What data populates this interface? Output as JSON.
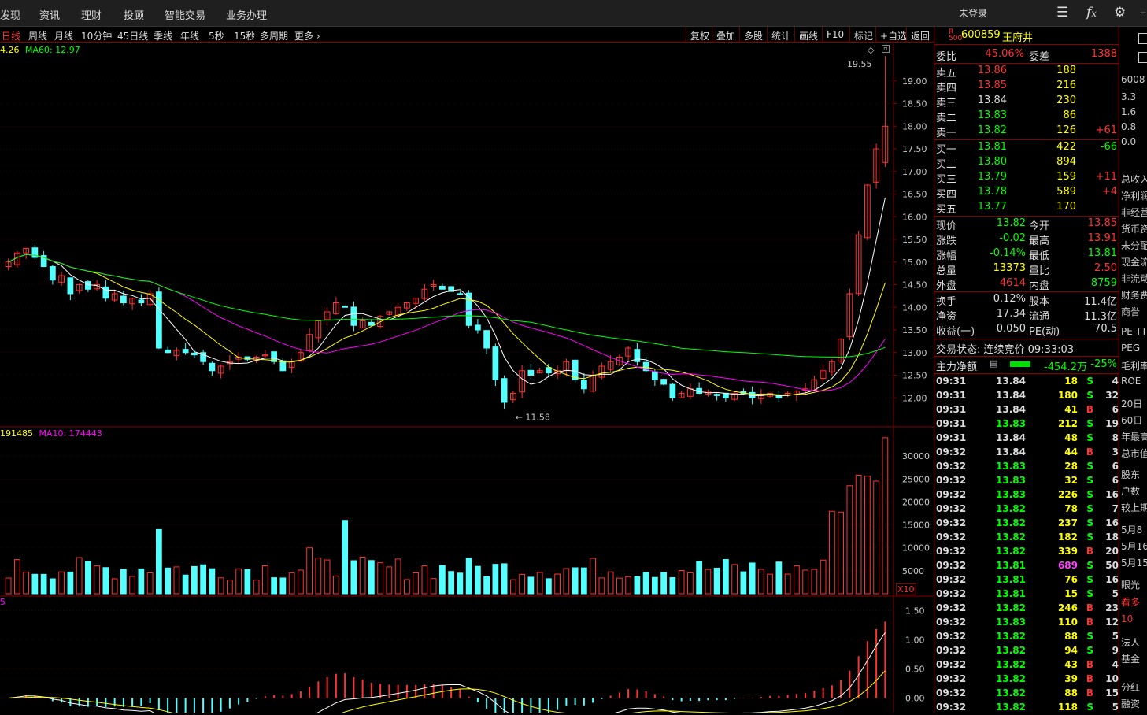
{
  "nav": {
    "items": [
      "发现",
      "资讯",
      "理财",
      "投顾",
      "智能交易",
      "业务办理"
    ],
    "login": "未登录"
  },
  "toolbar_icons": [
    "list-icon",
    "fx-icon",
    "gear-icon",
    "minimize-icon"
  ],
  "periods": [
    "日线",
    "周线",
    "月线",
    "10分钟",
    "45日线",
    "季线",
    "年线",
    "5秒",
    "15秒",
    "多周期",
    "更多"
  ],
  "tools": [
    "复权",
    "叠加",
    "多股",
    "统计",
    "画线",
    "F10",
    "标记",
    "+自选",
    "返回"
  ],
  "legends": {
    "price": {
      "a": "4.26",
      "b": "MA60: 12.97"
    },
    "volume": {
      "a": "191485",
      "b": "MA10: 174443"
    },
    "macd": {
      "a": "5"
    },
    "x10": "X10"
  },
  "colors": {
    "up": "#ff3232",
    "down": "#54ffff",
    "ma5": "#ffffff",
    "ma10": "#ffff00",
    "ma20": "#ff00ff",
    "ma60": "#00ff00",
    "panelBorder": "#880000"
  },
  "chart_data": {
    "type": "candlestick",
    "price_ticks": [
      "19.00",
      "18.50",
      "18.00",
      "17.50",
      "17.00",
      "16.50",
      "16.00",
      "15.50",
      "15.00",
      "14.50",
      "14.00",
      "13.50",
      "13.00",
      "12.50",
      "12.00"
    ],
    "price_range": [
      11.5,
      19.5
    ],
    "max_label": "19.55",
    "min_label": "11.58",
    "volume_ticks": [
      "30000",
      "25000",
      "20000",
      "15000",
      "10000",
      "5000"
    ],
    "volume_range": [
      0,
      35000
    ],
    "macd_ticks": [
      "1.50",
      "1.00",
      "0.50",
      "0.00"
    ],
    "macd_range": [
      -0.25,
      1.75
    ],
    "close_series": [
      15.0,
      15.2,
      15.3,
      15.1,
      14.9,
      14.6,
      14.7,
      14.3,
      14.5,
      14.4,
      14.5,
      14.2,
      14.3,
      14.1,
      14.2,
      14.1,
      14.3,
      13.1,
      13.0,
      13.05,
      13.0,
      12.95,
      12.8,
      12.6,
      12.7,
      12.8,
      12.9,
      12.85,
      12.9,
      12.95,
      12.8,
      12.6,
      12.8,
      13.0,
      13.4,
      13.7,
      13.9,
      14.1,
      14.0,
      13.6,
      13.7,
      13.6,
      13.8,
      13.9,
      14.0,
      14.1,
      14.2,
      14.4,
      14.5,
      14.4,
      14.35,
      14.3,
      13.6,
      13.5,
      13.1,
      12.4,
      11.9,
      12.1,
      12.6,
      12.5,
      12.6,
      12.55,
      12.6,
      12.8,
      12.4,
      12.2,
      12.5,
      12.7,
      12.8,
      12.9,
      13.1,
      12.8,
      12.6,
      12.4,
      12.3,
      12.0,
      12.1,
      12.2,
      12.1,
      12.15,
      12.05,
      12.0,
      12.1,
      12.1,
      12.0,
      12.05,
      12.1,
      12.0,
      12.1,
      12.15,
      12.2,
      12.4,
      12.6,
      12.8,
      13.3,
      14.3,
      15.6,
      16.7,
      17.5,
      18.0
    ]
  },
  "quote": {
    "code": "600859",
    "name": "王府井",
    "badge_r": "R",
    "badge_500": "500",
    "weibi_label": "委比",
    "weibi": "45.06%",
    "weicha_label": "委差",
    "weicha": "1388",
    "asks": [
      {
        "label": "卖五",
        "price": "13.86",
        "vol": "188",
        "chg": ""
      },
      {
        "label": "卖四",
        "price": "13.85",
        "vol": "216",
        "chg": ""
      },
      {
        "label": "卖三",
        "price": "13.84",
        "vol": "230",
        "chg": ""
      },
      {
        "label": "卖二",
        "price": "13.83",
        "vol": "86",
        "chg": ""
      },
      {
        "label": "卖一",
        "price": "13.82",
        "vol": "126",
        "chg": "+61"
      }
    ],
    "bids": [
      {
        "label": "买一",
        "price": "13.81",
        "vol": "422",
        "chg": "-66"
      },
      {
        "label": "买二",
        "price": "13.80",
        "vol": "894",
        "chg": ""
      },
      {
        "label": "买三",
        "price": "13.79",
        "vol": "159",
        "chg": "+11"
      },
      {
        "label": "买四",
        "price": "13.78",
        "vol": "589",
        "chg": "+4"
      },
      {
        "label": "买五",
        "price": "13.77",
        "vol": "170",
        "chg": ""
      }
    ],
    "stats": [
      {
        "l1": "现价",
        "v1": "13.82",
        "l2": "今开",
        "v2": "13.85"
      },
      {
        "l1": "涨跌",
        "v1": "-0.02",
        "l2": "最高",
        "v2": "13.91"
      },
      {
        "l1": "涨幅",
        "v1": "-0.14%",
        "l2": "最低",
        "v2": "13.81"
      },
      {
        "l1": "总量",
        "v1": "13373",
        "l2": "量比",
        "v2": "2.50"
      },
      {
        "l1": "外盘",
        "v1": "4614",
        "l2": "内盘",
        "v2": "8759"
      }
    ],
    "stats2": [
      {
        "l1": "换手",
        "v1": "0.12%",
        "l2": "股本",
        "v2": "11.4亿"
      },
      {
        "l1": "净资",
        "v1": "17.34",
        "l2": "流通",
        "v2": "11.3亿"
      },
      {
        "l1": "收益(一)",
        "v1": "0.050",
        "l2": "PE(动)",
        "v2": "70.5"
      }
    ],
    "status": "交易状态: 连续竞价 09:33:03",
    "net_label": "主力净额",
    "net_value": "-454.2万",
    "net_pct": "-25%",
    "ticks": [
      {
        "t": "09:31",
        "p": "13.84",
        "v": "18",
        "d": "S",
        "n": "4"
      },
      {
        "t": "09:31",
        "p": "13.84",
        "v": "180",
        "d": "S",
        "n": "32"
      },
      {
        "t": "09:31",
        "p": "13.84",
        "v": "41",
        "d": "B",
        "n": "6"
      },
      {
        "t": "09:31",
        "p": "13.83",
        "v": "212",
        "d": "S",
        "n": "19"
      },
      {
        "t": "09:31",
        "p": "13.84",
        "v": "48",
        "d": "S",
        "n": "8"
      },
      {
        "t": "09:32",
        "p": "13.84",
        "v": "44",
        "d": "B",
        "n": "3"
      },
      {
        "t": "09:32",
        "p": "13.83",
        "v": "28",
        "d": "S",
        "n": "6"
      },
      {
        "t": "09:32",
        "p": "13.83",
        "v": "32",
        "d": "S",
        "n": "6"
      },
      {
        "t": "09:32",
        "p": "13.83",
        "v": "226",
        "d": "S",
        "n": "16"
      },
      {
        "t": "09:32",
        "p": "13.82",
        "v": "78",
        "d": "S",
        "n": "7"
      },
      {
        "t": "09:32",
        "p": "13.82",
        "v": "237",
        "d": "S",
        "n": "16"
      },
      {
        "t": "09:32",
        "p": "13.82",
        "v": "182",
        "d": "S",
        "n": "18"
      },
      {
        "t": "09:32",
        "p": "13.82",
        "v": "339",
        "d": "B",
        "n": "20"
      },
      {
        "t": "09:32",
        "p": "13.81",
        "v": "689",
        "d": "S",
        "n": "50"
      },
      {
        "t": "09:32",
        "p": "13.81",
        "v": "76",
        "d": "S",
        "n": "16"
      },
      {
        "t": "09:32",
        "p": "13.81",
        "v": "15",
        "d": "S",
        "n": "5"
      },
      {
        "t": "09:32",
        "p": "13.82",
        "v": "246",
        "d": "B",
        "n": "23"
      },
      {
        "t": "09:32",
        "p": "13.83",
        "v": "110",
        "d": "B",
        "n": "12"
      },
      {
        "t": "09:32",
        "p": "13.82",
        "v": "88",
        "d": "S",
        "n": "5"
      },
      {
        "t": "09:32",
        "p": "13.82",
        "v": "94",
        "d": "S",
        "n": "9"
      },
      {
        "t": "09:32",
        "p": "13.82",
        "v": "43",
        "d": "B",
        "n": "4"
      },
      {
        "t": "09:32",
        "p": "13.82",
        "v": "39",
        "d": "B",
        "n": "10"
      },
      {
        "t": "09:32",
        "p": "13.82",
        "v": "88",
        "d": "B",
        "n": "15"
      },
      {
        "t": "09:32",
        "p": "13.82",
        "v": "118",
        "d": "S",
        "n": "5"
      }
    ]
  },
  "side": {
    "code": "6008",
    "nums": [
      "3.3",
      "1.6",
      "0.8",
      "0.0"
    ],
    "labels": [
      "总收入",
      "净利润",
      "非经营",
      "货币资金",
      "未分配",
      "现金流",
      "非流动",
      "财务费",
      "商誉",
      "PE TTM",
      "PEG",
      "毛利率",
      "ROE",
      "20日",
      "60日",
      "年最高",
      "总市值",
      "股东",
      "户数",
      "较上期",
      "5月8",
      "5月16",
      "5月15",
      "眼光",
      "看多",
      "10",
      "法人",
      "基金",
      "分红",
      "融资"
    ]
  }
}
